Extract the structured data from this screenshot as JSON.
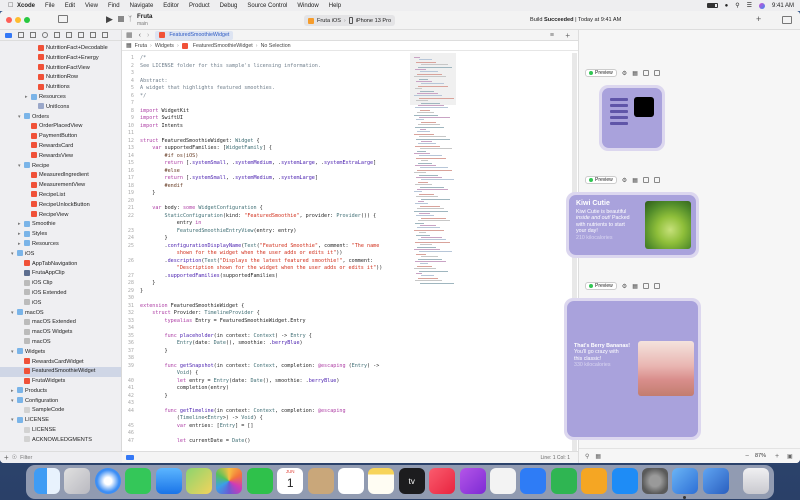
{
  "menubar": {
    "items": [
      "Xcode",
      "File",
      "Edit",
      "View",
      "Find",
      "Navigate",
      "Editor",
      "Product",
      "Debug",
      "Source Control",
      "Window",
      "Help"
    ],
    "time": "9:41 AM"
  },
  "toolbar": {
    "project_name": "Fruta",
    "branch": "main",
    "scheme": "Fruta iOS",
    "device": "iPhone 13 Pro",
    "status_prefix": "Build",
    "status_bold": "Succeeded",
    "status_suffix": "| Today at 9:41 AM",
    "tab_label": "FeaturedSmoothieWidget"
  },
  "jumpbar": {
    "project": "Fruta",
    "folder": "Widgets",
    "file": "FeaturedSmoothieWidget",
    "symbol": "No Selection"
  },
  "navigator": {
    "filter_placeholder": "Filter",
    "rows": [
      {
        "label": "NutritionFact+Decodable",
        "indent": 4,
        "icon": "swift",
        "disc": ""
      },
      {
        "label": "NutritionFact+Energy",
        "indent": 4,
        "icon": "swift",
        "disc": ""
      },
      {
        "label": "NutritionFactView",
        "indent": 4,
        "icon": "swift",
        "disc": ""
      },
      {
        "label": "NutritionRow",
        "indent": 4,
        "icon": "swift",
        "disc": ""
      },
      {
        "label": "Nutritions",
        "indent": 4,
        "icon": "swift",
        "disc": ""
      },
      {
        "label": "Resources",
        "indent": 3,
        "icon": "folder",
        "disc": ">"
      },
      {
        "label": "UnitIcons",
        "indent": 4,
        "icon": "asset",
        "disc": ""
      },
      {
        "label": "Orders",
        "indent": 2,
        "icon": "folder",
        "disc": "v"
      },
      {
        "label": "OrderPlacedView",
        "indent": 3,
        "icon": "swift",
        "disc": ""
      },
      {
        "label": "PaymentButton",
        "indent": 3,
        "icon": "swift",
        "disc": ""
      },
      {
        "label": "RewardsCard",
        "indent": 3,
        "icon": "swift",
        "disc": ""
      },
      {
        "label": "RewardsView",
        "indent": 3,
        "icon": "swift",
        "disc": ""
      },
      {
        "label": "Recipe",
        "indent": 2,
        "icon": "folder",
        "disc": "v"
      },
      {
        "label": "MeasuredIngredient",
        "indent": 3,
        "icon": "swift",
        "disc": ""
      },
      {
        "label": "MeasurementView",
        "indent": 3,
        "icon": "swift",
        "disc": ""
      },
      {
        "label": "RecipeList",
        "indent": 3,
        "icon": "swift",
        "disc": ""
      },
      {
        "label": "RecipeUnlockButton",
        "indent": 3,
        "icon": "swift",
        "disc": ""
      },
      {
        "label": "RecipeView",
        "indent": 3,
        "icon": "swift",
        "disc": ""
      },
      {
        "label": "Smoothie",
        "indent": 2,
        "icon": "folder",
        "disc": ">"
      },
      {
        "label": "Styles",
        "indent": 2,
        "icon": "folder",
        "disc": ">"
      },
      {
        "label": "Resources",
        "indent": 2,
        "icon": "folder",
        "disc": ">"
      },
      {
        "label": "iOS",
        "indent": 1,
        "icon": "folder",
        "disc": "v"
      },
      {
        "label": "AppTabNavigation",
        "indent": 2,
        "icon": "swift",
        "disc": ""
      },
      {
        "label": "FrutaAppClip",
        "indent": 2,
        "icon": "target",
        "disc": ""
      },
      {
        "label": "iOS Clip",
        "indent": 2,
        "icon": "plist",
        "disc": ""
      },
      {
        "label": "iOS Extended",
        "indent": 2,
        "icon": "plist",
        "disc": ""
      },
      {
        "label": "iOS",
        "indent": 2,
        "icon": "plist",
        "disc": ""
      },
      {
        "label": "macOS",
        "indent": 1,
        "icon": "folder",
        "disc": "v"
      },
      {
        "label": "macOS Extended",
        "indent": 2,
        "icon": "plist",
        "disc": ""
      },
      {
        "label": "macOS Widgets",
        "indent": 2,
        "icon": "plist",
        "disc": ""
      },
      {
        "label": "macOS",
        "indent": 2,
        "icon": "plist",
        "disc": ""
      },
      {
        "label": "Widgets",
        "indent": 1,
        "icon": "folder",
        "disc": "v"
      },
      {
        "label": "RewardsCardWidget",
        "indent": 2,
        "icon": "swift",
        "disc": ""
      },
      {
        "label": "FeaturedSmoothieWidget",
        "indent": 2,
        "icon": "swift",
        "disc": "",
        "selected": true
      },
      {
        "label": "FrutaWidgets",
        "indent": 2,
        "icon": "swift",
        "disc": ""
      },
      {
        "label": "Products",
        "indent": 1,
        "icon": "folder",
        "disc": ">"
      },
      {
        "label": "Configuration",
        "indent": 1,
        "icon": "folder",
        "disc": "v"
      },
      {
        "label": "SampleCode",
        "indent": 2,
        "icon": "doc",
        "disc": ""
      },
      {
        "label": "LICENSE",
        "indent": 1,
        "icon": "folder",
        "disc": "v"
      },
      {
        "label": "LICENSE",
        "indent": 2,
        "icon": "doc",
        "disc": ""
      },
      {
        "label": "ACKNOWLEDGMENTS",
        "indent": 2,
        "icon": "doc",
        "disc": ""
      }
    ]
  },
  "code": [
    {
      "n": "1",
      "t": [
        [
          "cm",
          "/*"
        ]
      ]
    },
    {
      "n": "2",
      "t": [
        [
          "cm",
          "See LICENSE folder for this sample's licensing information."
        ]
      ]
    },
    {
      "n": "3",
      "t": []
    },
    {
      "n": "4",
      "t": [
        [
          "cm",
          "Abstract:"
        ]
      ]
    },
    {
      "n": "5",
      "t": [
        [
          "cm",
          "A widget that highlights featured smoothies."
        ]
      ]
    },
    {
      "n": "6",
      "t": [
        [
          "cm",
          "*/"
        ]
      ]
    },
    {
      "n": "7",
      "t": []
    },
    {
      "n": "8",
      "t": [
        [
          "kw",
          "import"
        ],
        [
          "tk",
          " WidgetKit"
        ]
      ]
    },
    {
      "n": "9",
      "t": [
        [
          "kw",
          "import"
        ],
        [
          "tk",
          " SwiftUI"
        ]
      ]
    },
    {
      "n": "10",
      "t": [
        [
          "kw",
          "import"
        ],
        [
          "tk",
          " Intents"
        ]
      ]
    },
    {
      "n": "11",
      "t": []
    },
    {
      "n": "12",
      "t": [
        [
          "kw",
          "struct"
        ],
        [
          "tk",
          " FeaturedSmoothieWidget: "
        ],
        [
          "ty",
          "Widget"
        ],
        [
          "tk",
          " {"
        ]
      ]
    },
    {
      "n": "13",
      "t": [
        [
          "tk",
          "    "
        ],
        [
          "kw",
          "var"
        ],
        [
          "tk",
          " supportedFamilies: ["
        ],
        [
          "ty",
          "WidgetFamily"
        ],
        [
          "tk",
          "] {"
        ]
      ]
    },
    {
      "n": "14",
      "t": [
        [
          "pp",
          "        #if os(iOS)"
        ]
      ]
    },
    {
      "n": "15",
      "t": [
        [
          "tk",
          "        "
        ],
        [
          "kw",
          "return"
        ],
        [
          "tk",
          " [."
        ],
        [
          "fn",
          "systemSmall"
        ],
        [
          "tk",
          ", ."
        ],
        [
          "fn",
          "systemMedium"
        ],
        [
          "tk",
          ", ."
        ],
        [
          "fn",
          "systemLarge"
        ],
        [
          "tk",
          ", ."
        ],
        [
          "fn",
          "systemExtraLarge"
        ],
        [
          "tk",
          "]"
        ]
      ]
    },
    {
      "n": "16",
      "t": [
        [
          "pp",
          "        #else"
        ]
      ]
    },
    {
      "n": "17",
      "t": [
        [
          "tk",
          "        "
        ],
        [
          "kw",
          "return"
        ],
        [
          "tk",
          " [."
        ],
        [
          "fn",
          "systemSmall"
        ],
        [
          "tk",
          ", ."
        ],
        [
          "fn",
          "systemMedium"
        ],
        [
          "tk",
          ", ."
        ],
        [
          "fn",
          "systemLarge"
        ],
        [
          "tk",
          "]"
        ]
      ]
    },
    {
      "n": "18",
      "t": [
        [
          "pp",
          "        #endif"
        ]
      ]
    },
    {
      "n": "19",
      "t": [
        [
          "tk",
          "    }"
        ]
      ]
    },
    {
      "n": "20",
      "t": []
    },
    {
      "n": "21",
      "t": [
        [
          "tk",
          "    "
        ],
        [
          "kw",
          "var"
        ],
        [
          "tk",
          " body: "
        ],
        [
          "kw",
          "some"
        ],
        [
          "tk",
          " "
        ],
        [
          "ty",
          "WidgetConfiguration"
        ],
        [
          "tk",
          " {"
        ]
      ]
    },
    {
      "n": "22",
      "t": [
        [
          "tk",
          "        "
        ],
        [
          "ty",
          "StaticConfiguration"
        ],
        [
          "tk",
          "(kind: "
        ],
        [
          "st",
          "\"FeaturedSmoothie\""
        ],
        [
          "tk",
          ", provider: "
        ],
        [
          "ty",
          "Provider"
        ],
        [
          "tk",
          "()) {"
        ]
      ]
    },
    {
      "n": "",
      "t": [
        [
          "tk",
          "            entry "
        ],
        [
          "kw",
          "in"
        ]
      ]
    },
    {
      "n": "23",
      "t": [
        [
          "tk",
          "            "
        ],
        [
          "ty",
          "FeaturedSmoothieEntryView"
        ],
        [
          "tk",
          "(entry: entry)"
        ]
      ]
    },
    {
      "n": "24",
      "t": [
        [
          "tk",
          "        }"
        ]
      ]
    },
    {
      "n": "25",
      "t": [
        [
          "tk",
          "        ."
        ],
        [
          "fn",
          "configurationDisplayName"
        ],
        [
          "tk",
          "("
        ],
        [
          "ty",
          "Text"
        ],
        [
          "tk",
          "("
        ],
        [
          "st",
          "\"Featured Smoothie\""
        ],
        [
          "tk",
          ", comment: "
        ],
        [
          "st",
          "\"The name"
        ]
      ]
    },
    {
      "n": "",
      "t": [
        [
          "st",
          "            shown for the widget when the user adds or edits it\""
        ],
        [
          "tk",
          "))"
        ]
      ]
    },
    {
      "n": "26",
      "t": [
        [
          "tk",
          "        ."
        ],
        [
          "fn",
          "description"
        ],
        [
          "tk",
          "("
        ],
        [
          "ty",
          "Text"
        ],
        [
          "tk",
          "("
        ],
        [
          "st",
          "\"Displays the latest featured smoothie!\""
        ],
        [
          "tk",
          ", comment:"
        ]
      ]
    },
    {
      "n": "",
      "t": [
        [
          "st",
          "            \"Description shown for the widget when the user adds or edits it\""
        ],
        [
          "tk",
          "))"
        ]
      ]
    },
    {
      "n": "27",
      "t": [
        [
          "tk",
          "        ."
        ],
        [
          "fn",
          "supportedFamilies"
        ],
        [
          "tk",
          "(supportedFamilies)"
        ]
      ]
    },
    {
      "n": "28",
      "t": [
        [
          "tk",
          "    }"
        ]
      ]
    },
    {
      "n": "29",
      "t": [
        [
          "tk",
          "}"
        ]
      ]
    },
    {
      "n": "30",
      "t": []
    },
    {
      "n": "31",
      "t": [
        [
          "kw",
          "extension"
        ],
        [
          "tk",
          " FeaturedSmoothieWidget {"
        ]
      ]
    },
    {
      "n": "32",
      "t": [
        [
          "tk",
          "    "
        ],
        [
          "kw",
          "struct"
        ],
        [
          "tk",
          " Provider: "
        ],
        [
          "ty",
          "TimelineProvider"
        ],
        [
          "tk",
          " {"
        ]
      ]
    },
    {
      "n": "33",
      "t": [
        [
          "tk",
          "        "
        ],
        [
          "kw",
          "typealias"
        ],
        [
          "tk",
          " Entry = FeaturedSmoothieWidget.Entry"
        ]
      ]
    },
    {
      "n": "34",
      "t": []
    },
    {
      "n": "35",
      "t": [
        [
          "tk",
          "        "
        ],
        [
          "kw",
          "func"
        ],
        [
          "tk",
          " "
        ],
        [
          "fn",
          "placeholder"
        ],
        [
          "tk",
          "(in context: "
        ],
        [
          "ty",
          "Context"
        ],
        [
          "tk",
          ") -> "
        ],
        [
          "ty",
          "Entry"
        ],
        [
          "tk",
          " {"
        ]
      ]
    },
    {
      "n": "36",
      "t": [
        [
          "tk",
          "            "
        ],
        [
          "ty",
          "Entry"
        ],
        [
          "tk",
          "(date: "
        ],
        [
          "ty",
          "Date"
        ],
        [
          "tk",
          "(), smoothie: ."
        ],
        [
          "fn",
          "berryBlue"
        ],
        [
          "tk",
          ")"
        ]
      ]
    },
    {
      "n": "37",
      "t": [
        [
          "tk",
          "        }"
        ]
      ]
    },
    {
      "n": "38",
      "t": []
    },
    {
      "n": "39",
      "t": [
        [
          "tk",
          "        "
        ],
        [
          "kw",
          "func"
        ],
        [
          "tk",
          " "
        ],
        [
          "fn",
          "getSnapshot"
        ],
        [
          "tk",
          "(in context: "
        ],
        [
          "ty",
          "Context"
        ],
        [
          "tk",
          ", completion: "
        ],
        [
          "kw",
          "@escaping"
        ],
        [
          "tk",
          " ("
        ],
        [
          "ty",
          "Entry"
        ],
        [
          "tk",
          ") ->"
        ]
      ]
    },
    {
      "n": "",
      "t": [
        [
          "tk",
          "            "
        ],
        [
          "ty",
          "Void"
        ],
        [
          "tk",
          ") {"
        ]
      ]
    },
    {
      "n": "40",
      "t": [
        [
          "tk",
          "            "
        ],
        [
          "kw",
          "let"
        ],
        [
          "tk",
          " entry = "
        ],
        [
          "ty",
          "Entry"
        ],
        [
          "tk",
          "(date: "
        ],
        [
          "ty",
          "Date"
        ],
        [
          "tk",
          "(), smoothie: ."
        ],
        [
          "fn",
          "berryBlue"
        ],
        [
          "tk",
          ")"
        ]
      ]
    },
    {
      "n": "41",
      "t": [
        [
          "tk",
          "            completion(entry)"
        ]
      ]
    },
    {
      "n": "42",
      "t": [
        [
          "tk",
          "        }"
        ]
      ]
    },
    {
      "n": "43",
      "t": []
    },
    {
      "n": "44",
      "t": [
        [
          "tk",
          "        "
        ],
        [
          "kw",
          "func"
        ],
        [
          "tk",
          " "
        ],
        [
          "fn",
          "getTimeline"
        ],
        [
          "tk",
          "(in context: "
        ],
        [
          "ty",
          "Context"
        ],
        [
          "tk",
          ", completion: "
        ],
        [
          "kw",
          "@escaping"
        ]
      ]
    },
    {
      "n": "",
      "t": [
        [
          "tk",
          "            ("
        ],
        [
          "ty",
          "Timeline"
        ],
        [
          "tk",
          "<"
        ],
        [
          "ty",
          "Entry"
        ],
        [
          "tk",
          ">) -> "
        ],
        [
          "ty",
          "Void"
        ],
        [
          "tk",
          ") {"
        ]
      ]
    },
    {
      "n": "45",
      "t": [
        [
          "tk",
          "            "
        ],
        [
          "kw",
          "var"
        ],
        [
          "tk",
          " entries: ["
        ],
        [
          "ty",
          "Entry"
        ],
        [
          "tk",
          "] = []"
        ]
      ]
    },
    {
      "n": "46",
      "t": []
    },
    {
      "n": "47",
      "t": [
        [
          "tk",
          "            "
        ],
        [
          "kw",
          "let"
        ],
        [
          "tk",
          " currentDate = "
        ],
        [
          "ty",
          "Date"
        ],
        [
          "tk",
          "()"
        ]
      ]
    }
  ],
  "canvas": {
    "preview_label": "Preview",
    "zoom": "87%",
    "medium_widget": {
      "title": "Kiwi Cutie",
      "body_1": "Kiwi Cutie is beautiful",
      "body_2_em": "inside and out!",
      "body_2_rest": " Packed",
      "body_3": "with nutrients to start",
      "body_4": "your day!",
      "calories": "210 kilocalories"
    },
    "large_widget": {
      "title": "That's Berry Bananas!",
      "body_1": "You'll go crazy with",
      "body_2": "this classic!",
      "calories": "330 kilocalories"
    }
  },
  "statusbar": {
    "position": "Line: 1  Col: 1"
  },
  "dock": {
    "apps": [
      "finder-icon",
      "launchpad-icon",
      "safari-icon",
      "messages-icon",
      "mail-icon",
      "maps-icon",
      "photos-icon",
      "facetime-icon",
      "calendar-icon",
      "contacts-icon",
      "reminders-icon",
      "notes-icon",
      "appletv-icon",
      "music-icon",
      "podcasts-icon",
      "news-icon",
      "keynote-icon",
      "numbers-icon",
      "pages-icon",
      "appstore-icon",
      "systempreferences-icon",
      "xcode-icon",
      "simulator-icon",
      "trash-icon"
    ],
    "calendar_month": "JUN",
    "calendar_day": "1",
    "appletv_label": "tv"
  }
}
